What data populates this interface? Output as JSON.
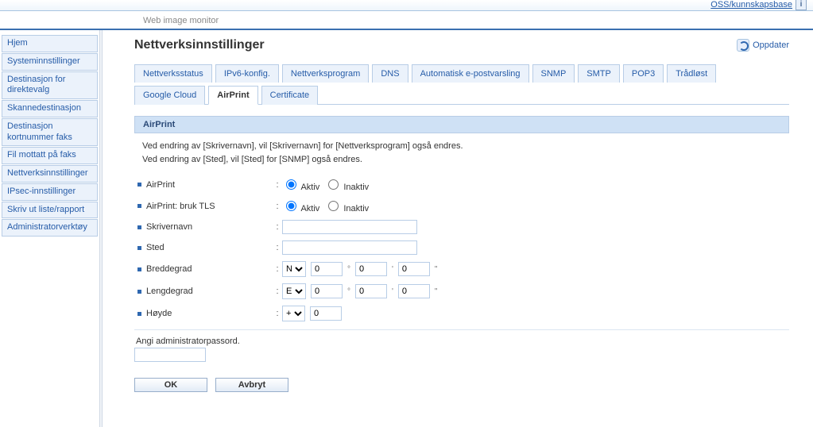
{
  "top": {
    "kb_link": "OSS/kunnskapsbase"
  },
  "brand": "Web image monitor",
  "sidebar": {
    "items": [
      "Hjem",
      "Systeminnstillinger",
      "Destinasjon for direktevalg",
      "Skannedestinasjon",
      "Destinasjon kortnummer faks",
      "Fil mottatt på faks",
      "Nettverksinnstillinger",
      "IPsec-innstillinger",
      "Skriv ut liste/rapport",
      "Administratorverktøy"
    ]
  },
  "page": {
    "title": "Nettverksinnstillinger",
    "refresh": "Oppdater"
  },
  "tabs": [
    "Nettverksstatus",
    "IPv6-konfig.",
    "Nettverksprogram",
    "DNS",
    "Automatisk e-postvarsling",
    "SNMP",
    "SMTP",
    "POP3",
    "Trådløst",
    "Google Cloud",
    "AirPrint",
    "Certificate"
  ],
  "active_tab_index": 10,
  "section": {
    "title": "AirPrint",
    "hint1": "Ved endring av [Skrivernavn], vil [Skrivernavn] for [Nettverksprogram] også endres.",
    "hint2": "Ved endring av [Sted], vil [Sted] for [SNMP] også endres."
  },
  "form": {
    "airprint_label": "AirPrint",
    "tls_label": "AirPrint: bruk TLS",
    "active": "Aktiv",
    "inactive": "Inaktiv",
    "printer_name_label": "Skrivernavn",
    "printer_name_value": "",
    "location_label": "Sted",
    "location_value": "",
    "lat_label": "Breddegrad",
    "lat_dir": "N",
    "lat_deg": "0",
    "lat_min": "0",
    "lat_sec": "0",
    "lon_label": "Lengdegrad",
    "lon_dir": "E",
    "lon_deg": "0",
    "lon_min": "0",
    "lon_sec": "0",
    "alt_label": "Høyde",
    "alt_sign": "+",
    "alt_value": "0",
    "deg_mark": "°",
    "min_mark": "'",
    "sec_mark": "\"",
    "airprint_selected": "active",
    "tls_selected": "active"
  },
  "admin": {
    "note": "Angi administratorpassord.",
    "value": ""
  },
  "actions": {
    "ok": "OK",
    "cancel": "Avbryt"
  }
}
